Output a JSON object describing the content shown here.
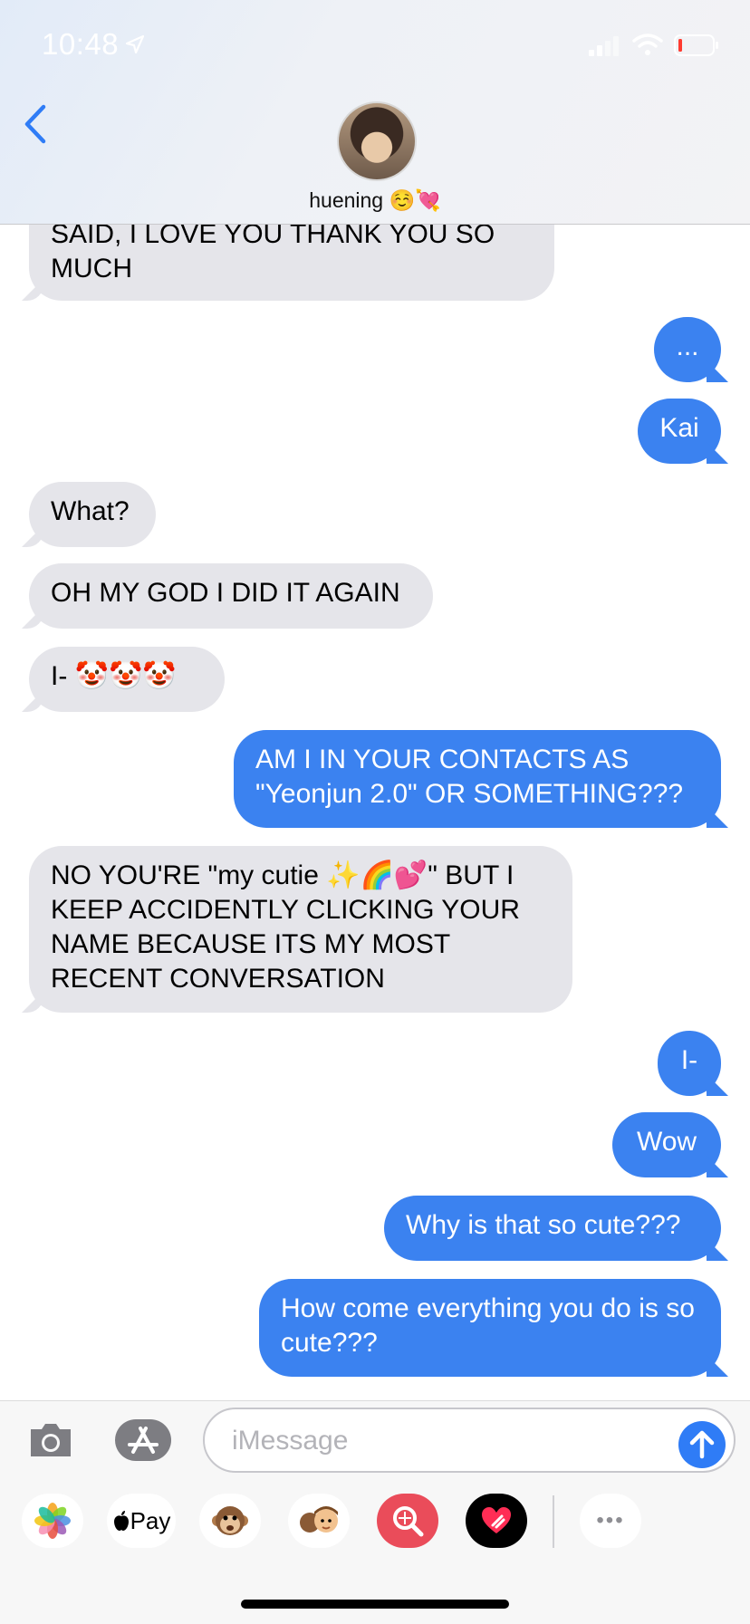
{
  "status_bar": {
    "time": "10:48"
  },
  "header": {
    "contact_name": "huening ☺️💘"
  },
  "messages": [
    {
      "text": "SAID, I LOVE YOU THANK YOU SO MUCH"
    },
    {
      "text": "..."
    },
    {
      "text": "Kai"
    },
    {
      "text": "What?"
    },
    {
      "text": "OH MY GOD I DID IT AGAIN"
    },
    {
      "text": "I- 🤡🤡🤡"
    },
    {
      "text": "AM I IN YOUR CONTACTS AS \"Yeonjun 2.0\" OR SOMETHING???"
    },
    {
      "text": "NO YOU'RE \"my cutie ✨🌈💕\" BUT I KEEP ACCIDENTLY CLICKING YOUR NAME BECAUSE ITS MY MOST RECENT CONVERSATION"
    },
    {
      "text": "I-"
    },
    {
      "text": "Wow"
    },
    {
      "text": "Why is that so cute???"
    },
    {
      "text": "How come everything you do is so cute???"
    }
  ],
  "composer": {
    "placeholder": "iMessage"
  },
  "app_drawer": {
    "apple_pay_label": "Pay",
    "more_label": "•••"
  },
  "icons": {
    "back": "chevron-left-icon",
    "camera": "camera-icon",
    "appstore": "app-store-icon",
    "send": "arrow-up-icon",
    "photos": "photos-icon",
    "monkey": "monkey-emoji-icon",
    "memoji": "memoji-icon",
    "search": "image-search-icon",
    "heart": "digital-touch-heart-icon"
  },
  "colors": {
    "outgoing": "#3b82f0",
    "incoming": "#e5e5ea",
    "accent": "#2f7cf6"
  }
}
